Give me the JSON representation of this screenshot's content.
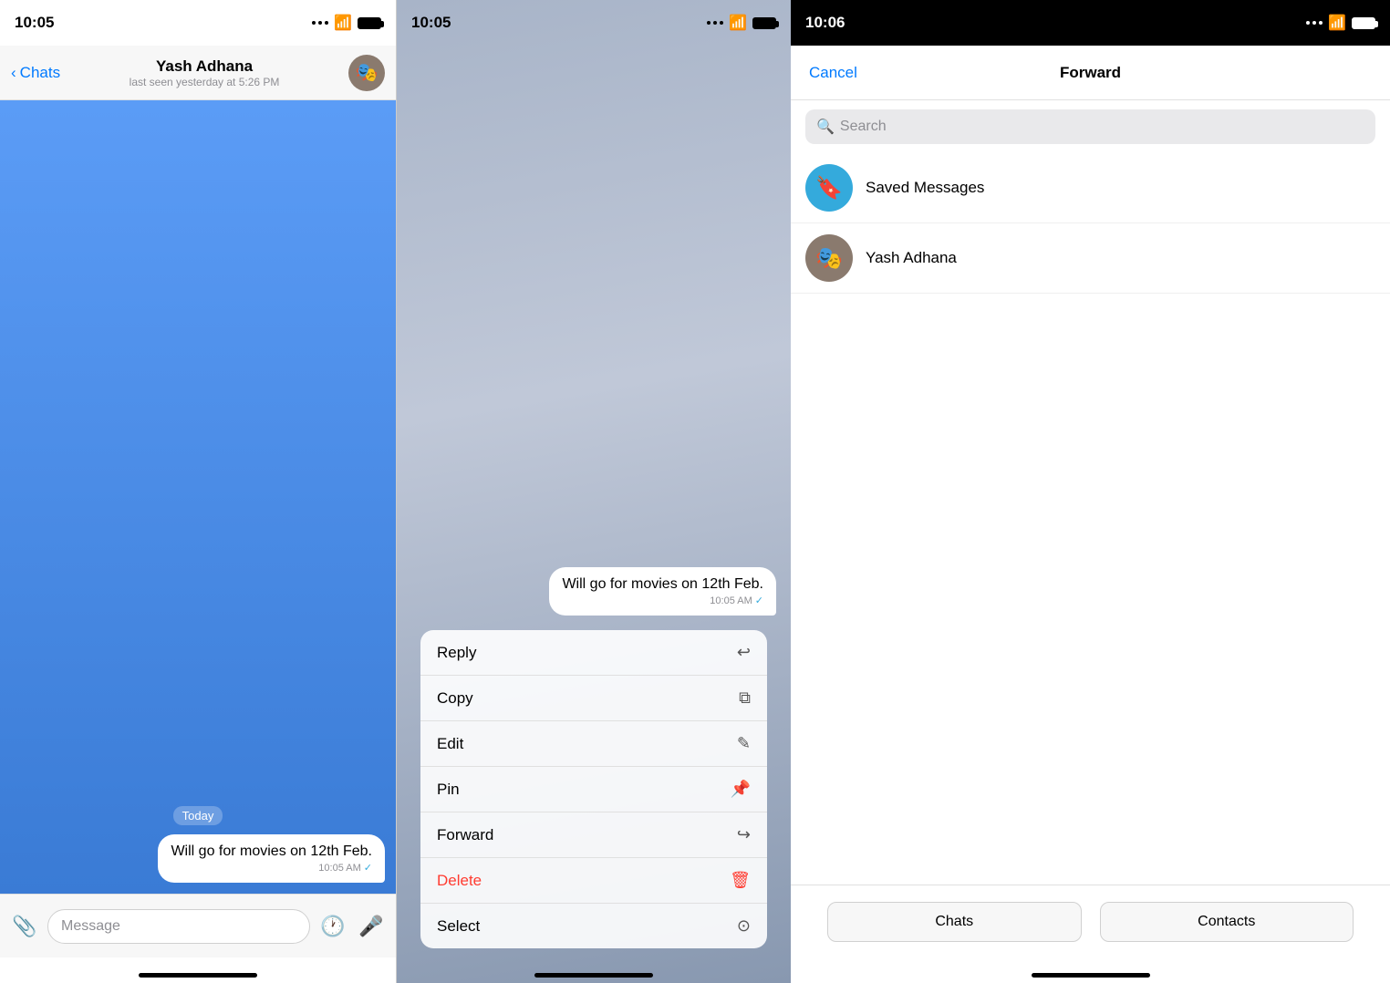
{
  "panel1": {
    "status_time": "10:05",
    "back_label": "Chats",
    "user_name": "Yash Adhana",
    "user_status": "last seen yesterday at 5:26 PM",
    "date_label": "Today",
    "message_text": "Will go for movies on 12th Feb.",
    "message_time": "10:05 AM",
    "message_check": "✓",
    "input_placeholder": "Message"
  },
  "panel2": {
    "status_time": "10:05",
    "message_text": "Will go for movies on 12th Feb.",
    "message_time": "10:05 AM",
    "message_check": "✓",
    "menu_items": [
      {
        "label": "Reply",
        "icon": "↩",
        "is_delete": false
      },
      {
        "label": "Copy",
        "icon": "⎘",
        "is_delete": false
      },
      {
        "label": "Edit",
        "icon": "✎",
        "is_delete": false
      },
      {
        "label": "Pin",
        "icon": "📌",
        "is_delete": false
      },
      {
        "label": "Forward",
        "icon": "↪",
        "is_delete": false
      },
      {
        "label": "Delete",
        "icon": "🗑",
        "is_delete": true
      },
      {
        "label": "Select",
        "icon": "◎",
        "is_delete": false
      }
    ]
  },
  "panel3": {
    "status_time": "10:06",
    "cancel_label": "Cancel",
    "title": "Forward",
    "search_placeholder": "Search",
    "contacts": [
      {
        "name": "Saved Messages",
        "avatar_type": "saved",
        "avatar_icon": "🔖"
      },
      {
        "name": "Yash Adhana",
        "avatar_type": "yash",
        "avatar_icon": "🎭"
      }
    ],
    "tab_chats": "Chats",
    "tab_contacts": "Contacts"
  }
}
